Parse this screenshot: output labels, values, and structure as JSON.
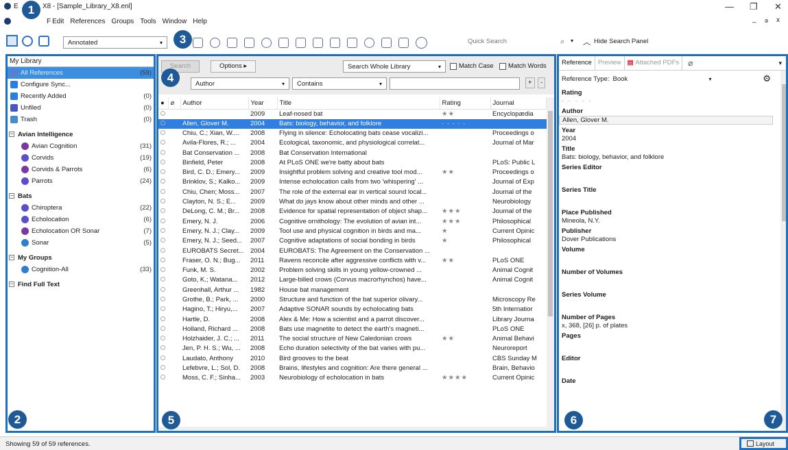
{
  "window": {
    "title_prefix": "E",
    "title_rest": "X8 - [Sample_Library_X8.enl]",
    "minimize": "—",
    "maximize": "❐",
    "close": "✕",
    "inner_min": "_",
    "inner_restore": "ǝ",
    "inner_close": "x"
  },
  "menu": {
    "file_partial": "F",
    "edit_partial": "Edit",
    "references": "References",
    "groups": "Groups",
    "tools": "Tools",
    "window": "Window",
    "help": "Help"
  },
  "toolbar": {
    "style": "Annotated",
    "quick_search_placeholder": "Quick Search",
    "hide_search_panel": "Hide Search Panel"
  },
  "badges": [
    "1",
    "2",
    "3",
    "4",
    "5",
    "6",
    "7"
  ],
  "left": {
    "library": "My Library",
    "top_items": [
      {
        "label": "All References",
        "count": "(59)",
        "icon_color": "#5b7fcf"
      },
      {
        "label": "Configure Sync...",
        "count": "",
        "icon_color": "#2a7de1"
      },
      {
        "label": "Recently Added",
        "count": "(0)",
        "icon_color": "#2a7de1"
      },
      {
        "label": "Unfiled",
        "count": "(0)",
        "icon_color": "#4a55c5"
      },
      {
        "label": "Trash",
        "count": "(0)",
        "icon_color": "#4a8ad0"
      }
    ],
    "groups": [
      {
        "name": "Avian Intelligence",
        "items": [
          {
            "label": "Avian Cognition",
            "count": "(31)",
            "icon_color": "#7a3aa0"
          },
          {
            "label": "Corvids",
            "count": "(19)",
            "icon_color": "#5b4fc9"
          },
          {
            "label": "Corvids & Parrots",
            "count": "(6)",
            "icon_color": "#7a3aa0"
          },
          {
            "label": "Parrots",
            "count": "(24)",
            "icon_color": "#5b4fc9"
          }
        ]
      },
      {
        "name": "Bats",
        "items": [
          {
            "label": "Chiroptera",
            "count": "(22)",
            "icon_color": "#5b4fc9"
          },
          {
            "label": "Echolocation",
            "count": "(6)",
            "icon_color": "#5b4fc9"
          },
          {
            "label": "Echolocation OR Sonar",
            "count": "(7)",
            "icon_color": "#7a3aa0"
          },
          {
            "label": "Sonar",
            "count": "(5)",
            "icon_color": "#2f7ed0"
          }
        ]
      },
      {
        "name": "My Groups",
        "items": [
          {
            "label": "Cognition-All",
            "count": "(33)",
            "icon_color": "#2f7ed0"
          }
        ]
      },
      {
        "name": "Find Full Text",
        "items": []
      }
    ]
  },
  "search": {
    "search_btn": "Search",
    "options_btn": "Options ▸",
    "scope": "Search Whole Library",
    "match_case": "Match Case",
    "match_words": "Match Words",
    "field": "Author",
    "operator": "Contains",
    "plus": "+",
    "minus": "-"
  },
  "table": {
    "headers": {
      "author": "Author",
      "year": "Year",
      "title": "Title",
      "rating": "Rating",
      "journal": "Journal"
    },
    "rows": [
      {
        "author": "",
        "year": "2009",
        "title": "Leaf-nosed bat",
        "rating": "★★",
        "journal": "Encyclopædia"
      },
      {
        "author": "Allen, Glover M.",
        "year": "2004",
        "title": "Bats: biology, behavior, and folklore",
        "rating": "· · · · ·",
        "journal": "",
        "selected": true
      },
      {
        "author": "Chiu, C.; Xian, W....",
        "year": "2008",
        "title": "Flying in silence: Echolocating bats cease vocalizi...",
        "rating": "",
        "journal": "Proceedings o"
      },
      {
        "author": "Avila-Flores, R.; ...",
        "year": "2004",
        "title": "Ecological, taxonomic, and physiological correlat...",
        "rating": "",
        "journal": "Journal of Mar"
      },
      {
        "author": "Bat Conservation ...",
        "year": "2008",
        "title": "Bat Conservation International",
        "rating": "",
        "journal": ""
      },
      {
        "author": "Binfield, Peter",
        "year": "2008",
        "title": "At PLoS ONE we're batty about bats",
        "rating": "",
        "journal": "PLoS: Public L"
      },
      {
        "author": "Bird, C. D.; Emery...",
        "year": "2009",
        "title": "Insightful problem solving and creative tool mod...",
        "rating": "★★",
        "journal": "Proceedings o"
      },
      {
        "author": "Brinklov, S.; Kalko...",
        "year": "2009",
        "title": "Intense echolocation calls from two 'whispering' ...",
        "rating": "",
        "journal": "Journal of Exp"
      },
      {
        "author": "Chiu, Chen; Moss...",
        "year": "2007",
        "title": "The role of the external ear in vertical sound local...",
        "rating": "",
        "journal": "Journal of the"
      },
      {
        "author": "Clayton, N. S.; E...",
        "year": "2009",
        "title": "What do jays know about other minds and other ...",
        "rating": "",
        "journal": "Neurobiology"
      },
      {
        "author": "DeLong, C. M.; Br...",
        "year": "2008",
        "title": "Evidence for spatial representation of object shap...",
        "rating": "★★★",
        "journal": "Journal of the"
      },
      {
        "author": "Emery, N. J.",
        "year": "2006",
        "title": "Cognitive ornithology: The evolution of avian int...",
        "rating": "★★★",
        "journal": "Philosophical"
      },
      {
        "author": "Emery, N. J.; Clay...",
        "year": "2009",
        "title": "Tool use and physical cognition in birds and ma...",
        "rating": "★",
        "journal": "Current Opinic"
      },
      {
        "author": "Emery, N. J.; Seed...",
        "year": "2007",
        "title": "Cognitive adaptations of social bonding in birds",
        "rating": "★",
        "journal": "Philosophical"
      },
      {
        "author": "EUROBATS Secret...",
        "year": "2004",
        "title": "EUROBATS: The Agreement on the Conservation ...",
        "rating": "",
        "journal": ""
      },
      {
        "author": "Fraser, O. N.; Bug...",
        "year": "2011",
        "title": "Ravens reconcile after aggressive conflicts with v...",
        "rating": "★★",
        "journal": "PLoS ONE"
      },
      {
        "author": "Funk, M. S.",
        "year": "2002",
        "title": "Problem solving skills in young yellow-crowned ...",
        "rating": "",
        "journal": "Animal Cognit"
      },
      {
        "author": "Goto, K.; Watana...",
        "year": "2012",
        "title": "Large-billed crows (Corvus macrorhynchos) have...",
        "rating": "",
        "journal": "Animal Cognit"
      },
      {
        "author": "Greenhall, Arthur ...",
        "year": "1982",
        "title": "House bat management",
        "rating": "",
        "journal": ""
      },
      {
        "author": "Grothe, B.; Park, ...",
        "year": "2000",
        "title": "Structure and function of the bat superior olivary...",
        "rating": "",
        "journal": "Microscopy Re"
      },
      {
        "author": "Hagino, T.; Hiryu,...",
        "year": "2007",
        "title": "Adaptive SONAR sounds by echolocating bats",
        "rating": "",
        "journal": "5th Internatior"
      },
      {
        "author": "Hartle, D.",
        "year": "2008",
        "title": "Alex & Me: How a scientist and a parrot discover...",
        "rating": "",
        "journal": "Library Journa"
      },
      {
        "author": "Holland, Richard ...",
        "year": "2008",
        "title": "Bats use magnetite to detect the earth's magneti...",
        "rating": "",
        "journal": "PLoS ONE"
      },
      {
        "author": "Holzhaider, J. C.; ...",
        "year": "2011",
        "title": "The social structure of New Caledonian crows",
        "rating": "★★",
        "journal": "Animal Behavi"
      },
      {
        "author": "Jen, P. H. S.; Wu, ...",
        "year": "2008",
        "title": "Echo duration selectivity of the bat varies with pu...",
        "rating": "",
        "journal": "Neuroreport"
      },
      {
        "author": "Laudato, Anthony",
        "year": "2010",
        "title": "Bird grooves to the beat",
        "rating": "",
        "journal": "CBS Sunday M"
      },
      {
        "author": "Lefebvre, L.; Sol, D.",
        "year": "2008",
        "title": "Brains, lifestyles and cognition: Are there general ...",
        "rating": "",
        "journal": "Brain, Behavio"
      },
      {
        "author": "Moss, C. F.; Sinha...",
        "year": "2003",
        "title": "Neurobiology of echolocation in bats",
        "rating": "★★★★",
        "journal": "Current Opinic"
      }
    ]
  },
  "right": {
    "tabs": [
      "Reference",
      "Preview",
      "Attached PDFs"
    ],
    "ref_type_label": "Reference Type:",
    "ref_type": "Book",
    "fields": [
      {
        "label": "Rating",
        "value": "· · · · ·"
      },
      {
        "label": "Author",
        "value": "Allen, Glover M."
      },
      {
        "label": "Year",
        "value": "2004"
      },
      {
        "label": "Title",
        "value": "Bats: biology, behavior, and folklore"
      },
      {
        "label": "Series Editor",
        "value": ""
      },
      {
        "label": "Series Title",
        "value": ""
      },
      {
        "label": "Place Published",
        "value": "Mineola, N.Y."
      },
      {
        "label": "Publisher",
        "value": "Dover Publications"
      },
      {
        "label": "Volume",
        "value": ""
      },
      {
        "label": "Number of Volumes",
        "value": ""
      },
      {
        "label": "Series Volume",
        "value": ""
      },
      {
        "label": "Number of Pages",
        "value": "x, 368, [26] p. of plates"
      },
      {
        "label": "Pages",
        "value": ""
      },
      {
        "label": "Editor",
        "value": ""
      }
    ],
    "partial_bottom": "Date"
  },
  "status": {
    "text": "Showing 59 of 59 references.",
    "layout": "Layout"
  }
}
